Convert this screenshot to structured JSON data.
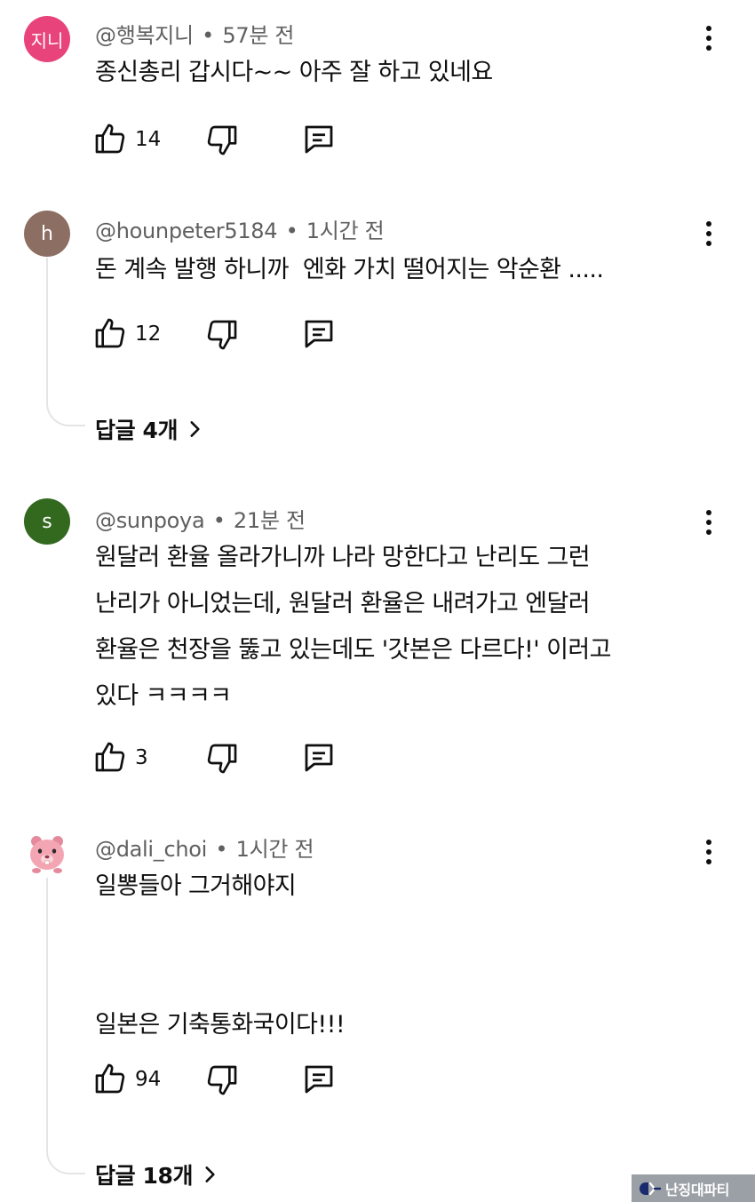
{
  "comments": [
    {
      "avatar_text": "지니",
      "avatar_color": "#e8437a",
      "author": "@행복지니",
      "separator": "•",
      "time": "57분 전",
      "text": "종신총리 갑시다~~ 아주 잘 하고 있네요",
      "likes": "14"
    },
    {
      "avatar_text": "h",
      "avatar_color": "#8d6e63",
      "author": "@hounpeter5184",
      "separator": "•",
      "time": "1시간 전",
      "text": "돈 계속 발행 하니까  엔화 가치 떨어지는 악순환 .....",
      "likes": "12",
      "replies_label": "답글 4개"
    },
    {
      "avatar_text": "s",
      "avatar_color": "#33691e",
      "author": "@sunpoya",
      "separator": "•",
      "time": "21분 전",
      "text": "원달러 환율 올라가니까 나라 망한다고 난리도 그런\n난리가 아니었는데, 원달러 환율은 내려가고 엔달러\n환율은 천장을 뚫고 있는데도 '갓본은 다르다!' 이러고\n있다 ㅋㅋㅋㅋ",
      "likes": "3"
    },
    {
      "avatar_icon": "pink-beaver-icon",
      "author": "@dali_choi",
      "separator": "•",
      "time": "1시간 전",
      "text": "일뽕들아 그거해야지\n\n\n일본은 기축통화국이다!!!",
      "likes": "94",
      "replies_label": "답글 18개"
    }
  ],
  "watermark": {
    "text": "난징대파티",
    "color": "#9aa0a6"
  }
}
